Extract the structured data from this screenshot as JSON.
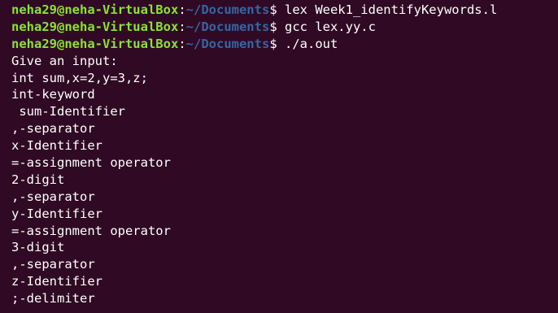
{
  "terminal": {
    "colors": {
      "background": "#300a24",
      "prompt_user": "#8ae234",
      "prompt_path": "#3465a4",
      "text": "#ffffff"
    },
    "prompts": [
      {
        "user_host": "neha29@neha-VirtualBox",
        "colon": ":",
        "path": "~/Documents",
        "dollar": "$",
        "command": " lex Week1_identifyKeywords.l"
      },
      {
        "user_host": "neha29@neha-VirtualBox",
        "colon": ":",
        "path": "~/Documents",
        "dollar": "$",
        "command": " gcc lex.yy.c"
      },
      {
        "user_host": "neha29@neha-VirtualBox",
        "colon": ":",
        "path": "~/Documents",
        "dollar": "$",
        "command": " ./a.out"
      }
    ],
    "output": [
      "Give an input:",
      "int sum,x=2,y=3,z;",
      "int-keyword",
      " sum-Identifier",
      ",-separator",
      "x-Identifier",
      "=-assignment operator",
      "2-digit",
      ",-separator",
      "y-Identifier",
      "=-assignment operator",
      "3-digit",
      ",-separator",
      "z-Identifier",
      ";-delimiter"
    ]
  }
}
